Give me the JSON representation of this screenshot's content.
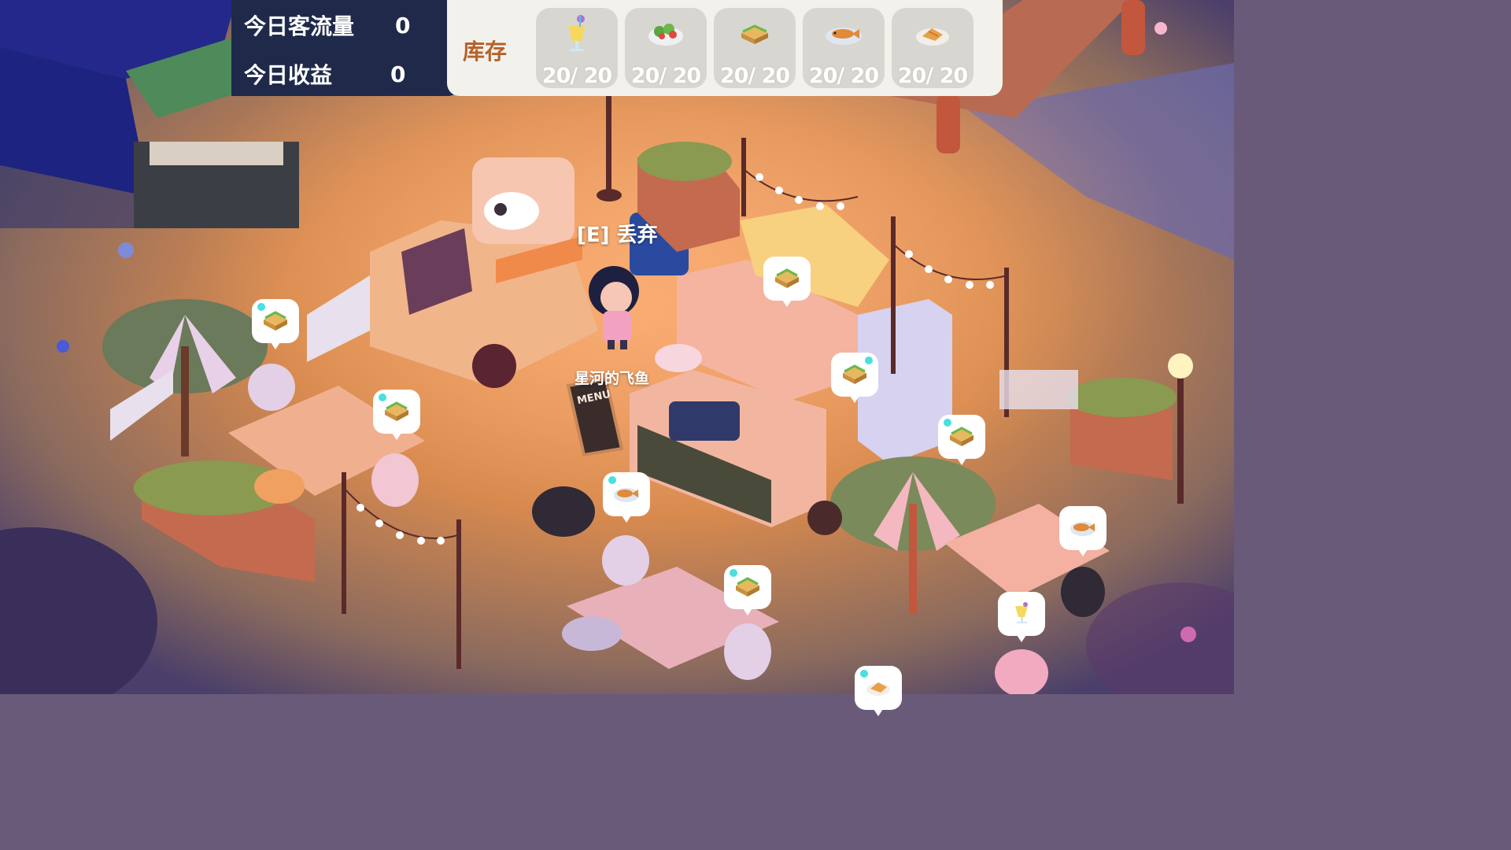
{
  "hud": {
    "stats": [
      {
        "label": "今日客流量",
        "value": "0"
      },
      {
        "label": "今日收益",
        "value": "0"
      }
    ],
    "inventory": {
      "title": "库存",
      "items": [
        {
          "icon": "cocktail-icon",
          "count": "20/ 20"
        },
        {
          "icon": "salad-icon",
          "count": "20/ 20"
        },
        {
          "icon": "sandwich-icon",
          "count": "20/ 20"
        },
        {
          "icon": "grilled-fish-icon",
          "count": "20/ 20"
        },
        {
          "icon": "fried-fish-icon",
          "count": "20/ 20"
        }
      ]
    }
  },
  "world": {
    "interaction_prompt": "[E] 丢弃",
    "player_name": "星河的飞鱼",
    "menu_sign": "MENU",
    "order_bubbles": [
      {
        "food": "sandwich-icon",
        "waiting": true
      },
      {
        "food": "sandwich-icon",
        "waiting": true
      },
      {
        "food": "sandwich-icon",
        "waiting": false
      },
      {
        "food": "sandwich-icon",
        "waiting": true
      },
      {
        "food": "grilled-fish-icon",
        "waiting": true
      },
      {
        "food": "sandwich-icon",
        "waiting": true
      },
      {
        "food": "sandwich-icon",
        "waiting": true
      },
      {
        "food": "grilled-fish-icon",
        "waiting": false
      },
      {
        "food": "cocktail-icon",
        "waiting": false
      },
      {
        "food": "fried-fish-icon",
        "waiting": true
      }
    ]
  },
  "colors": {
    "hud_dark": "#1f2a4a",
    "hud_light": "#f3f1ec",
    "stock_title": "#b5622c",
    "slot_bg": "#d8d6d0",
    "waiting_dot": "#48e0e0"
  }
}
